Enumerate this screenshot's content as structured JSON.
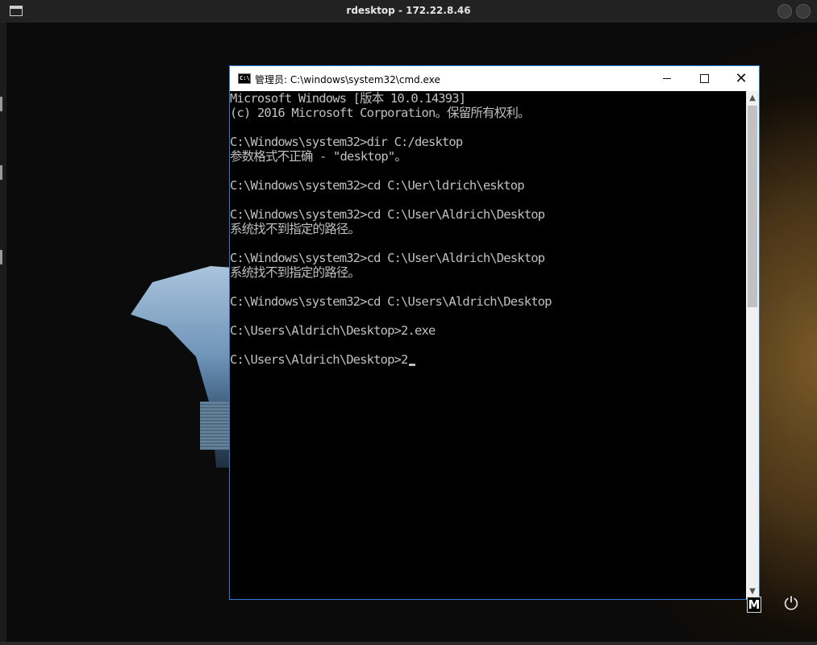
{
  "host": {
    "title": "rdesktop - 172.22.8.46"
  },
  "cmd_window": {
    "icon_text": "C:\\",
    "title": "管理员: C:\\windows\\system32\\cmd.exe",
    "minimize_glyph": "",
    "close_glyph": "✕"
  },
  "console": {
    "lines": [
      "Microsoft Windows [版本 10.0.14393]",
      "(c) 2016 Microsoft Corporation。保留所有权利。",
      "",
      "C:\\Windows\\system32>dir C:/desktop",
      "参数格式不正确 - \"desktop\"。",
      "",
      "C:\\Windows\\system32>cd C:\\Uer\\ldrich\\esktop",
      "",
      "C:\\Windows\\system32>cd C:\\User\\Aldrich\\Desktop",
      "系统找不到指定的路径。",
      "",
      "C:\\Windows\\system32>cd C:\\User\\Aldrich\\Desktop",
      "系统找不到指定的路径。",
      "",
      "C:\\Windows\\system32>cd C:\\Users\\Aldrich\\Desktop",
      "",
      "C:\\Users\\Aldrich\\Desktop>2.exe",
      "",
      "C:\\Users\\Aldrich\\Desktop>2"
    ]
  },
  "scrollbar": {
    "up_arrow": "▲",
    "down_arrow": "▼"
  },
  "tray": {
    "input_method": "M",
    "power_icon": "⏻"
  },
  "colors": {
    "console_text": "#c0c0c0",
    "window_border": "#2b7ad6",
    "console_bg": "#000000"
  }
}
